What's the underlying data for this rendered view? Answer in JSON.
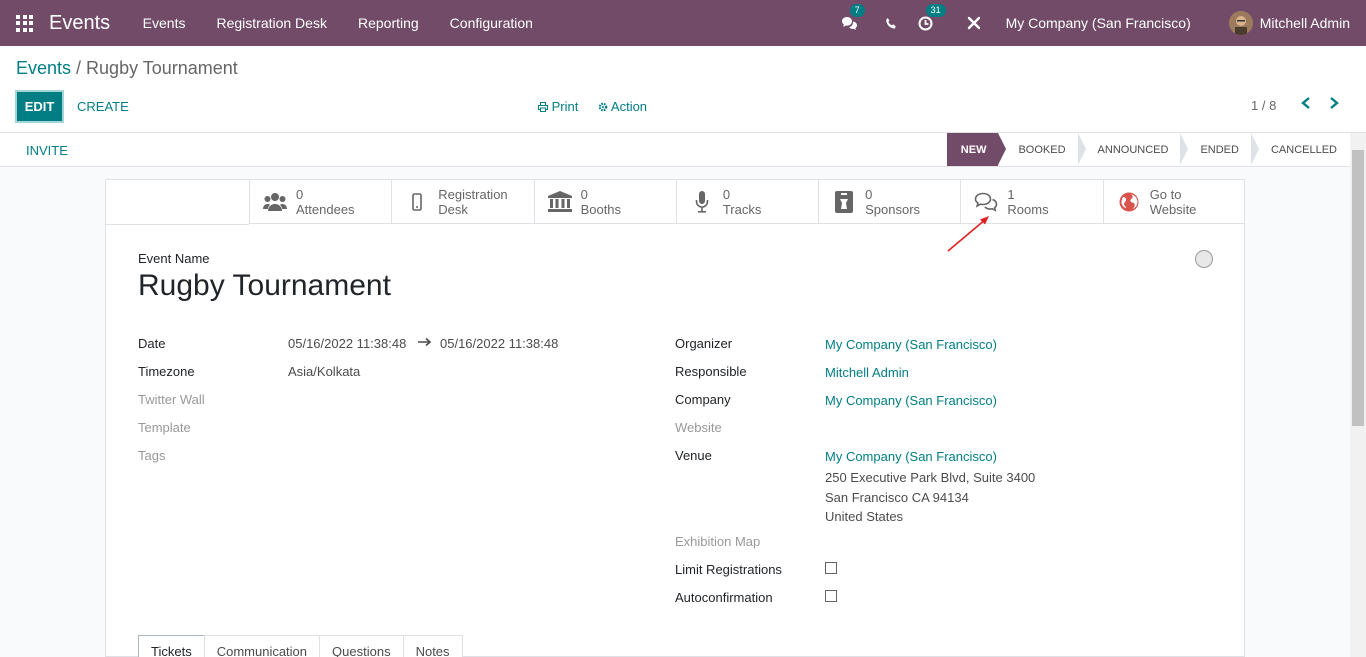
{
  "navbar": {
    "brand": "Events",
    "menu": [
      "Events",
      "Registration Desk",
      "Reporting",
      "Configuration"
    ],
    "chat_count": "7",
    "activity_count": "31",
    "company": "My Company (San Francisco)",
    "user": "Mitchell Admin",
    "colors": {
      "primary": "#714b67",
      "badge": "#017e84"
    }
  },
  "breadcrumb": {
    "parent": "Events",
    "separator": " / ",
    "current": "Rugby Tournament"
  },
  "toolbar": {
    "edit": "EDIT",
    "create": "CREATE",
    "print": "Print",
    "action": "Action"
  },
  "pager": {
    "value": "1 / 8"
  },
  "statusbar": {
    "invite": "INVITE",
    "stages": [
      "NEW",
      "BOOKED",
      "ANNOUNCED",
      "ENDED",
      "CANCELLED"
    ],
    "active_stage": "NEW"
  },
  "smart_buttons": [
    {
      "top": "0",
      "bottom": "Attendees",
      "icon": "users-icon"
    },
    {
      "top": "Registration",
      "bottom": "Desk",
      "icon": "mobile-icon"
    },
    {
      "top": "0",
      "bottom": "Booths",
      "icon": "bank-icon"
    },
    {
      "top": "0",
      "bottom": "Tracks",
      "icon": "microphone-icon"
    },
    {
      "top": "0",
      "bottom": "Sponsors",
      "icon": "sponsor-badge-icon"
    },
    {
      "top": "1",
      "bottom": "Rooms",
      "icon": "comments-icon"
    },
    {
      "top": "Go to",
      "bottom": "Website",
      "icon": "globe-icon"
    }
  ],
  "form": {
    "event_name_label": "Event Name",
    "event_name": "Rugby Tournament",
    "left": {
      "date_label": "Date",
      "date_start": "05/16/2022 11:38:48",
      "date_end": "05/16/2022 11:38:48",
      "timezone_label": "Timezone",
      "timezone": "Asia/Kolkata",
      "twitter_wall_label": "Twitter Wall",
      "template_label": "Template",
      "tags_label": "Tags"
    },
    "right": {
      "organizer_label": "Organizer",
      "organizer": "My Company (San Francisco)",
      "responsible_label": "Responsible",
      "responsible": "Mitchell Admin",
      "company_label": "Company",
      "company": "My Company (San Francisco)",
      "website_label": "Website",
      "venue_label": "Venue",
      "venue_name": "My Company (San Francisco)",
      "venue_street": "250 Executive Park Blvd, Suite 3400",
      "venue_city": "San Francisco CA 94134",
      "venue_country": "United States",
      "exhibition_map_label": "Exhibition Map",
      "limit_registrations_label": "Limit Registrations",
      "autoconfirmation_label": "Autoconfirmation"
    }
  },
  "tabs": [
    "Tickets",
    "Communication",
    "Questions",
    "Notes"
  ]
}
